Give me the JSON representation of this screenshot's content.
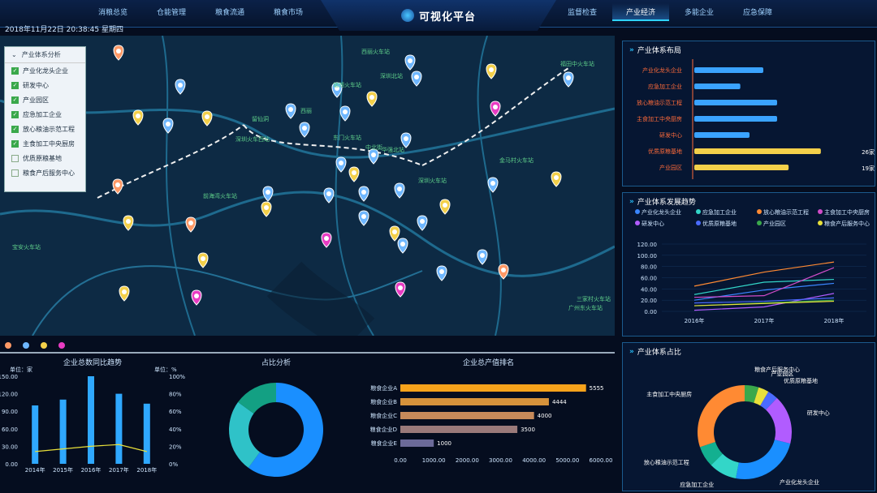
{
  "nav_left": [
    "消粮总览",
    "仓能管理",
    "粮食流通",
    "粮食市场"
  ],
  "nav_right": [
    "监督检查",
    "产业经济",
    "多能企业",
    "应急保障"
  ],
  "active_nav": "产业经济",
  "title": "可视化平台",
  "datetime": "2018年11月22日 20:38:45 星期四",
  "map": {
    "legend_title": "产业体系分析",
    "legend_items": [
      {
        "label": "产业化龙头企业",
        "checked": true
      },
      {
        "label": "研发中心",
        "checked": true
      },
      {
        "label": "产业园区",
        "checked": true
      },
      {
        "label": "应急加工企业",
        "checked": true
      },
      {
        "label": "放心粮油示范工程",
        "checked": true
      },
      {
        "label": "主食加工中央厨房",
        "checked": true
      },
      {
        "label": "优质原粮基地",
        "checked": false
      },
      {
        "label": "粮食产后服务中心",
        "checked": false
      }
    ],
    "place_labels": [
      "西丽火车站",
      "深圳北站",
      "塘朗火车站",
      "留仙洞",
      "西丽",
      "深圳火车西站",
      "东门火车站",
      "中北街",
      "深圳火车站",
      "华强北站",
      "金马村火车站",
      "福田中火车站",
      "宝安火车站",
      "前海湾火车站",
      "三家村火车站",
      "广州东火车站"
    ],
    "category_colors": [
      "#ff9966",
      "#6fb7ff",
      "#f3d04a",
      "#e83cc3"
    ]
  },
  "chart_data": [
    {
      "type": "bar",
      "panel": "layout",
      "title": "产业体系布局",
      "categories": [
        "产业化龙头企业",
        "应急加工企业",
        "放心粮油示范工程",
        "主食加工中央厨房",
        "研发中心",
        "优质原粮基地",
        "产业园区"
      ],
      "values": [
        3,
        2,
        3.6,
        3.6,
        2.4,
        5.5,
        4.1
      ],
      "value_labels": [
        "",
        "",
        "",
        "",
        "",
        "26家",
        "19家"
      ],
      "colors": [
        "#3aa3ff",
        "#3aa3ff",
        "#3aa3ff",
        "#3aa3ff",
        "#3aa3ff",
        "#f4d04a",
        "#f4d04a"
      ]
    },
    {
      "type": "line",
      "panel": "trend",
      "title": "产业体系发展趋势",
      "x": [
        "2016年",
        "2017年",
        "2018年"
      ],
      "ylim": [
        0,
        120
      ],
      "yticks": [
        "120.00",
        "100.00",
        "80.00",
        "60.00",
        "40.00",
        "20.00",
        "0.00"
      ],
      "series": [
        {
          "name": "产业化龙头企业",
          "color": "#3a86ff",
          "values": [
            20,
            38,
            50
          ]
        },
        {
          "name": "应急加工企业",
          "color": "#33d6c8",
          "values": [
            30,
            52,
            57
          ]
        },
        {
          "name": "放心粮油示范工程",
          "color": "#ff8a33",
          "values": [
            45,
            70,
            88
          ]
        },
        {
          "name": "主食加工中央厨房",
          "color": "#d14cc9",
          "values": [
            25,
            28,
            78
          ]
        },
        {
          "name": "研发中心",
          "color": "#b15cff",
          "values": [
            2,
            8,
            32
          ]
        },
        {
          "name": "优质原粮基地",
          "color": "#4a6bff",
          "values": [
            15,
            18,
            24
          ]
        },
        {
          "name": "产业园区",
          "color": "#3aa84b",
          "values": [
            10,
            15,
            20
          ]
        },
        {
          "name": "粮食产后服务中心",
          "color": "#e8e03a",
          "values": [
            10,
            14,
            18
          ]
        }
      ]
    },
    {
      "type": "pie",
      "panel": "share",
      "title": "产业体系占比",
      "labels": [
        "粮食产后服务中心",
        "产业园区",
        "优质原粮基地",
        "研发中心",
        "产业化龙头企业",
        "应急加工企业",
        "放心粮油示范工程",
        "主食加工中央厨房"
      ],
      "values": [
        4,
        3,
        3,
        14,
        20,
        8,
        6,
        25
      ],
      "colors": [
        "#3aa84b",
        "#e8e03a",
        "#4a6bff",
        "#b15cff",
        "#1a8fff",
        "#33d6c8",
        "#13b090",
        "#ff8a33"
      ]
    },
    {
      "type": "bar",
      "panel": "yoy",
      "title": "企业总数同比趋势",
      "unit_left": "单位：家",
      "unit_right": "单位：%",
      "categories": [
        "2014年",
        "2015年",
        "2016年",
        "2017年",
        "2018年"
      ],
      "values": [
        100,
        110,
        150,
        120,
        103
      ],
      "line_values": [
        14,
        17,
        20,
        22,
        14
      ],
      "ylim": [
        0,
        150
      ],
      "yticks": [
        "150.00",
        "120.00",
        "90.00",
        "60.00",
        "30.00",
        "0.00"
      ],
      "y2ticks": [
        "100%",
        "80%",
        "60%",
        "40%",
        "20%",
        "0%"
      ]
    },
    {
      "type": "pie",
      "panel": "ratio",
      "title": "占比分析",
      "values": [
        60,
        25,
        15
      ],
      "colors": [
        "#1a8fff",
        "#2fc2c8",
        "#13a083"
      ]
    },
    {
      "type": "bar",
      "panel": "rank",
      "title": "企业总产值排名",
      "categories": [
        "粮食企业A",
        "粮食企业B",
        "粮食企业C",
        "粮食企业D",
        "粮食企业E"
      ],
      "values": [
        5555,
        4444,
        4000,
        3500,
        1000
      ],
      "colors": [
        "#f7a21b",
        "#d6923b",
        "#c68a5a",
        "#9a7a7a",
        "#6b6a99"
      ],
      "xlim": [
        0,
        6000
      ],
      "xticks": [
        "0.00",
        "1000.00",
        "2000.00",
        "3000.00",
        "4000.00",
        "5000.00",
        "6000.00"
      ]
    }
  ]
}
